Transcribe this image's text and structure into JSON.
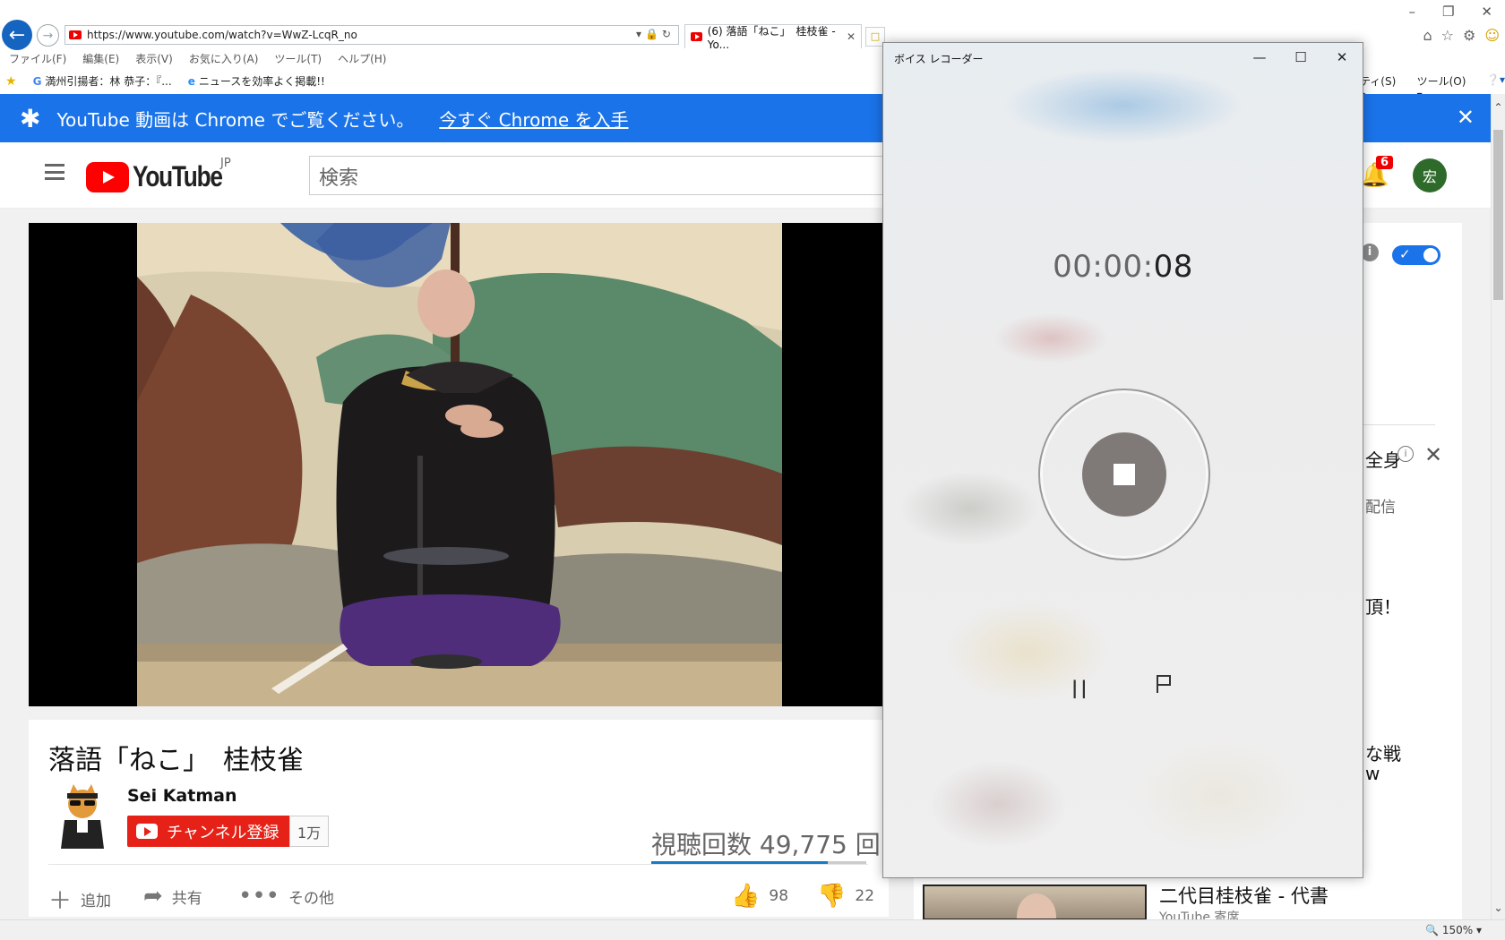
{
  "browser": {
    "url": "https://www.youtube.com/watch?v=WwZ-LcqR_no",
    "tab_title": "(6) 落語「ねこ」　桂枝雀 - Yo...",
    "menu": [
      "ファイル(F)",
      "編集(E)",
      "表示(V)",
      "お気に入り(A)",
      "ツール(T)",
      "ヘルプ(H)"
    ],
    "favorites": [
      "満州引揚者：林 恭子：『...",
      "ニュースを効率よく掲載!!"
    ],
    "command_bar": [
      "ティ(S) ▾",
      "ツール(O) ▾"
    ],
    "zoom": "150%"
  },
  "banner": {
    "text": "YouTube 動画は Chrome でご覧ください。",
    "link": "今すぐ Chrome を入手"
  },
  "youtube": {
    "logo_text": "YouTube",
    "region": "JP",
    "search_placeholder": "検索",
    "notification_count": "6",
    "avatar_initial": "宏"
  },
  "video": {
    "title": "落語「ねこ」　桂枝雀",
    "channel": "Sei Katman",
    "subscribe_label": "チャンネル登録",
    "subscriber_count": "1万",
    "view_count": "視聴回数 49,775 回",
    "like_ratio": 0.82,
    "actions": {
      "add": "追加",
      "share": "共有",
      "more": "その他"
    },
    "likes": "98",
    "dislikes": "22"
  },
  "sidebar": {
    "fragments": [
      "全身",
      "配信",
      "頂！",
      "な戦",
      "w"
    ],
    "next_title": "二代目桂枝雀 - 代書",
    "next_channel": "YouTube 寄席"
  },
  "recorder": {
    "window_title": "ボイス レコーダー",
    "timer_hm": "00:00:",
    "timer_s": "08"
  },
  "colors": {
    "banner_blue": "#1a73e8",
    "youtube_red": "#ff0000",
    "subscribe_red": "#e62117",
    "recorder_stop": "#7f7a78"
  }
}
